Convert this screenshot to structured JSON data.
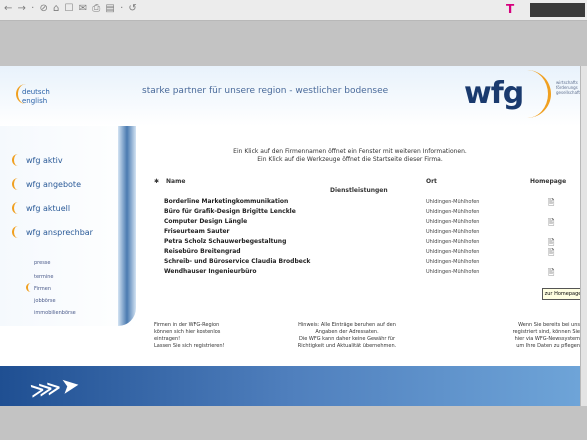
{
  "toolbar": {
    "icons": "← → · ⊘ ⌂ ☐ ✉ ⎙ ▤ · ↺",
    "logo": "T",
    "menu": ""
  },
  "header": {
    "lang_de": "deutsch",
    "lang_en": "english",
    "tagline": "starke partner für unsere region - westlicher bodensee",
    "logo": "wfg",
    "logo_sub": "wirtschafts förderungs gesellschaft"
  },
  "sidebar": {
    "nav": [
      "wfg aktiv",
      "wfg angebote",
      "wfg aktuell",
      "wfg ansprechbar"
    ],
    "sub": [
      "presse",
      "termine",
      "Firmen",
      "jobbörse",
      "immobilienbörse"
    ]
  },
  "info": {
    "line1": "Ein Klick auf den Firmennamen öffnet ein Fenster mit weiteren Informationen.",
    "line2": "Ein Klick auf die Werkzeuge öffnet die Startseite dieser Firma."
  },
  "table": {
    "col_name": "Name",
    "col_ort": "Ort",
    "col_hp": "Homepage",
    "category": "Dienstleistungen",
    "rows": [
      {
        "name": "Borderline Marketingkommunikation",
        "ort": "Uhldingen-Mühlhofen",
        "hp": "🖹"
      },
      {
        "name": "Büro für Grafik-Design Brigitte Lenckle",
        "ort": "Uhldingen-Mühlhofen",
        "hp": ""
      },
      {
        "name": "Computer Design Längle",
        "ort": "Uhldingen-Mühlhofen",
        "hp": "🖹"
      },
      {
        "name": "Friseurteam Sauter",
        "ort": "Uhldingen-Mühlhofen",
        "hp": ""
      },
      {
        "name": "Petra Scholz Schauwerbegestaltung",
        "ort": "Uhldingen-Mühlhofen",
        "hp": "🖹"
      },
      {
        "name": "Reisebüro Breitengrad",
        "ort": "Uhldingen-Mühlhofen",
        "hp": "🖹"
      },
      {
        "name": "Schreib- und Büroservice Claudia Brodbeck",
        "ort": "Uhldingen-Mühlhofen",
        "hp": ""
      },
      {
        "name": "Wendhauser Ingenieurbüro",
        "ort": "Uhldingen-Mühlhofen",
        "hp": "🖹"
      }
    ],
    "tooltip": "zur Homepage"
  },
  "footer": {
    "col1": [
      "Firmen in der WFG-Region",
      "können sich hier kostenlos",
      "eintragen!",
      "Lassen Sie sich registrieren!"
    ],
    "col2": [
      "Hinweis: Alle Einträge beruhen auf den",
      "Angaben der Adressaten.",
      "Die WFG kann daher keine Gewähr für",
      "Richtigkeit und Aktualität übernehmen."
    ],
    "col3": [
      "Wenn Sie bereits bei uns",
      "registriert sind, können Sie",
      "hier via WFG-Newssystem",
      "um Ihre Daten zu pflegen"
    ]
  }
}
